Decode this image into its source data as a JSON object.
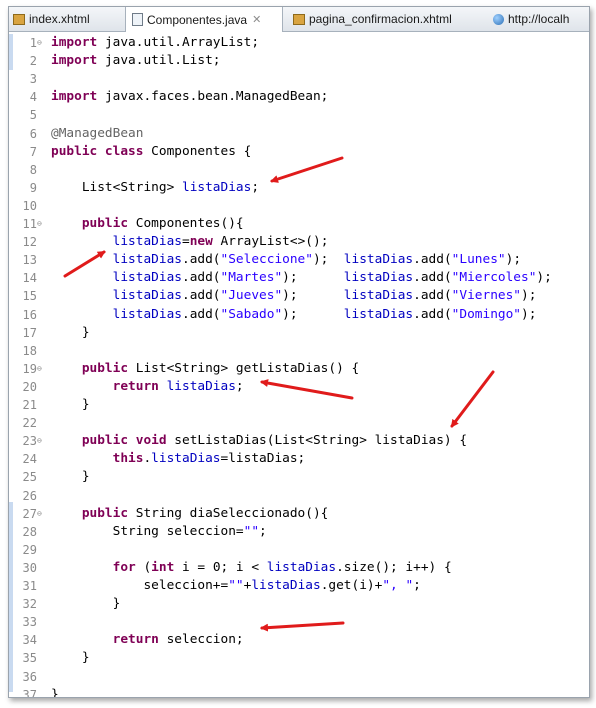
{
  "editor": {
    "tabs": [
      {
        "label": "index.xhtml",
        "icon": "xhtml-file-icon"
      },
      {
        "label": "Componentes.java",
        "icon": "java-file-icon",
        "close": "✕"
      },
      {
        "label": "pagina_confirmacion.xhtml",
        "icon": "xhtml-file-icon"
      },
      {
        "label": "http://localh",
        "icon": "globe-icon"
      }
    ],
    "lines": [
      {
        "n": "1",
        "fold": "⊖",
        "t": [
          [
            "kw",
            "import"
          ],
          [
            "",
            "java.util.ArrayList;"
          ]
        ]
      },
      {
        "n": "2",
        "t": [
          [
            "kw",
            "import"
          ],
          [
            "",
            "java.util.List;"
          ]
        ]
      },
      {
        "n": "3",
        "t": []
      },
      {
        "n": "4",
        "t": [
          [
            "kw",
            "import"
          ],
          [
            "",
            "javax.faces.bean.ManagedBean;"
          ]
        ]
      },
      {
        "n": "5",
        "t": []
      },
      {
        "n": "6",
        "t": [
          [
            "ann",
            "@ManagedBean"
          ]
        ]
      },
      {
        "n": "7",
        "t": [
          [
            "kw",
            "public class"
          ],
          [
            "",
            "Componentes {"
          ]
        ]
      },
      {
        "n": "8",
        "t": []
      },
      {
        "n": "9",
        "t": [
          [
            "",
            "    List<String> "
          ],
          [
            "fld",
            "listaDias"
          ],
          [
            "",
            ";"
          ]
        ]
      },
      {
        "n": "10",
        "t": []
      },
      {
        "n": "11",
        "fold": "⊖",
        "t": [
          [
            "kw",
            "    public"
          ],
          [
            "",
            " Componentes(){"
          ]
        ]
      },
      {
        "n": "12",
        "t": [
          [
            "fld",
            "        listaDias"
          ],
          [
            "",
            "="
          ],
          [
            "kw",
            "new"
          ],
          [
            "",
            " ArrayList<>();"
          ]
        ]
      },
      {
        "n": "13",
        "t": [
          [
            "fld",
            "        listaDias"
          ],
          [
            "",
            ".add("
          ],
          [
            "str",
            "\"Seleccione\""
          ],
          [
            "",
            ");  "
          ],
          [
            "fld",
            "listaDias"
          ],
          [
            "",
            ".add("
          ],
          [
            "str",
            "\"Lunes\""
          ],
          [
            "",
            ");"
          ]
        ]
      },
      {
        "n": "14",
        "t": [
          [
            "fld",
            "        listaDias"
          ],
          [
            "",
            ".add("
          ],
          [
            "str",
            "\"Martes\""
          ],
          [
            "",
            ");      "
          ],
          [
            "fld",
            "listaDias"
          ],
          [
            "",
            ".add("
          ],
          [
            "str",
            "\"Miercoles\""
          ],
          [
            "",
            ");"
          ]
        ]
      },
      {
        "n": "15",
        "t": [
          [
            "fld",
            "        listaDias"
          ],
          [
            "",
            ".add("
          ],
          [
            "str",
            "\"Jueves\""
          ],
          [
            "",
            ");      "
          ],
          [
            "fld",
            "listaDias"
          ],
          [
            "",
            ".add("
          ],
          [
            "str",
            "\"Viernes\""
          ],
          [
            "",
            ");"
          ]
        ]
      },
      {
        "n": "16",
        "t": [
          [
            "fld",
            "        listaDias"
          ],
          [
            "",
            ".add("
          ],
          [
            "str",
            "\"Sabado\""
          ],
          [
            "",
            ");      "
          ],
          [
            "fld",
            "listaDias"
          ],
          [
            "",
            ".add("
          ],
          [
            "str",
            "\"Domingo\""
          ],
          [
            "",
            ");"
          ]
        ]
      },
      {
        "n": "17",
        "t": [
          [
            "",
            "    }"
          ]
        ]
      },
      {
        "n": "18",
        "t": []
      },
      {
        "n": "19",
        "fold": "⊖",
        "t": [
          [
            "kw",
            "    public"
          ],
          [
            "",
            " List<String> getListaDias() {"
          ]
        ]
      },
      {
        "n": "20",
        "t": [
          [
            "kw",
            "        return"
          ],
          [
            "fld",
            " listaDias"
          ],
          [
            "",
            ";"
          ]
        ]
      },
      {
        "n": "21",
        "t": [
          [
            "",
            "    }"
          ]
        ]
      },
      {
        "n": "22",
        "t": []
      },
      {
        "n": "23",
        "fold": "⊖",
        "t": [
          [
            "kw",
            "    public void"
          ],
          [
            "",
            " setListaDias(List<String> listaDias) {"
          ]
        ]
      },
      {
        "n": "24",
        "t": [
          [
            "kw",
            "        this"
          ],
          [
            "",
            "."
          ],
          [
            "fld",
            "listaDias"
          ],
          [
            "",
            "=listaDias;"
          ]
        ]
      },
      {
        "n": "25",
        "t": [
          [
            "",
            "    }"
          ]
        ]
      },
      {
        "n": "26",
        "t": []
      },
      {
        "n": "27",
        "fold": "⊖",
        "t": [
          [
            "kw",
            "    public"
          ],
          [
            "",
            " String diaSeleccionado(){"
          ]
        ]
      },
      {
        "n": "28",
        "t": [
          [
            "",
            "        String seleccion="
          ],
          [
            "str",
            "\"\""
          ],
          [
            "",
            ";"
          ]
        ]
      },
      {
        "n": "29",
        "t": []
      },
      {
        "n": "30",
        "t": [
          [
            "kw",
            "        for"
          ],
          [
            "",
            " ("
          ],
          [
            "kw",
            "int"
          ],
          [
            "",
            " i = 0; i < "
          ],
          [
            "fld",
            "listaDias"
          ],
          [
            "",
            ".size(); i++) {"
          ]
        ]
      },
      {
        "n": "31",
        "t": [
          [
            "",
            "            seleccion+="
          ],
          [
            "str",
            "\"\""
          ],
          [
            "",
            "+"
          ],
          [
            "fld",
            "listaDias"
          ],
          [
            "",
            ".get(i)+"
          ],
          [
            "str",
            "\", \""
          ],
          [
            "",
            ";"
          ]
        ]
      },
      {
        "n": "32",
        "t": [
          [
            "",
            "        }"
          ]
        ]
      },
      {
        "n": "33",
        "t": []
      },
      {
        "n": "34",
        "t": [
          [
            "kw",
            "        return"
          ],
          [
            "",
            " seleccion;"
          ]
        ]
      },
      {
        "n": "35",
        "t": [
          [
            "",
            "    }"
          ]
        ]
      },
      {
        "n": "36",
        "t": []
      },
      {
        "n": "37",
        "t": [
          [
            "",
            "}"
          ]
        ]
      }
    ]
  },
  "annotation_color": "#e01b1b",
  "keyword_color": "#7f0055",
  "field_color": "#0000c0",
  "string_color": "#2a00ff"
}
